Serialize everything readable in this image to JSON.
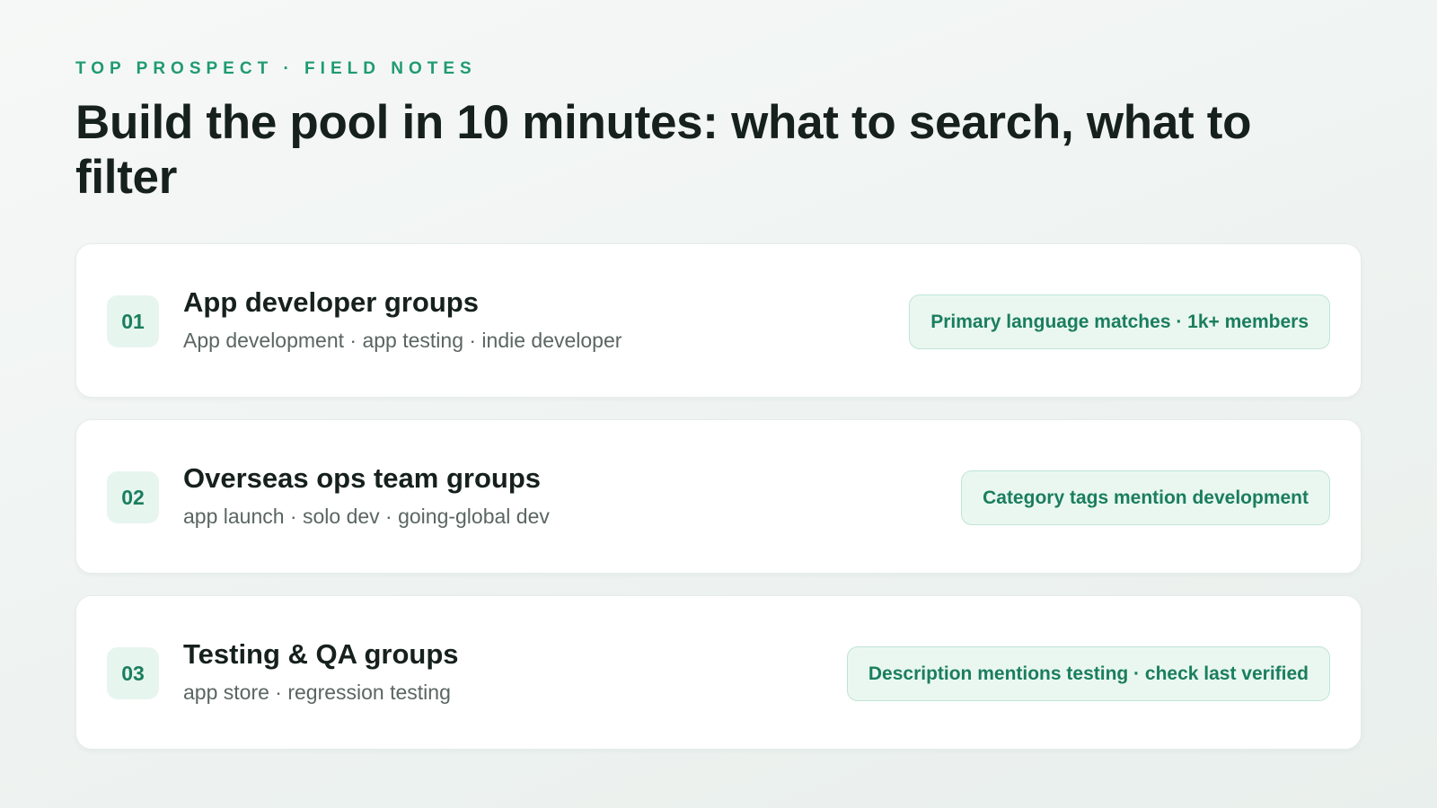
{
  "header": {
    "eyebrow": "TOP PROSPECT · FIELD NOTES",
    "title": "Build the pool in 10 minutes: what to search, what to filter"
  },
  "cards": [
    {
      "number": "01",
      "title": "App developer groups",
      "keywords": "App development · app testing · indie developer",
      "filter": "Primary language matches · 1k+ members"
    },
    {
      "number": "02",
      "title": "Overseas ops team groups",
      "keywords": "app launch · solo dev · going-global dev",
      "filter": "Category tags mention development"
    },
    {
      "number": "03",
      "title": "Testing & QA groups",
      "keywords": "app store · regression testing",
      "filter": "Description mentions testing · check last verified"
    }
  ],
  "colors": {
    "accent": "#1f9a72",
    "accent_dark": "#1a7e5e",
    "badge_bg": "#e7f5ef",
    "pill_border": "#bfe4d4",
    "heading": "#16201c",
    "muted": "#5a6661"
  }
}
